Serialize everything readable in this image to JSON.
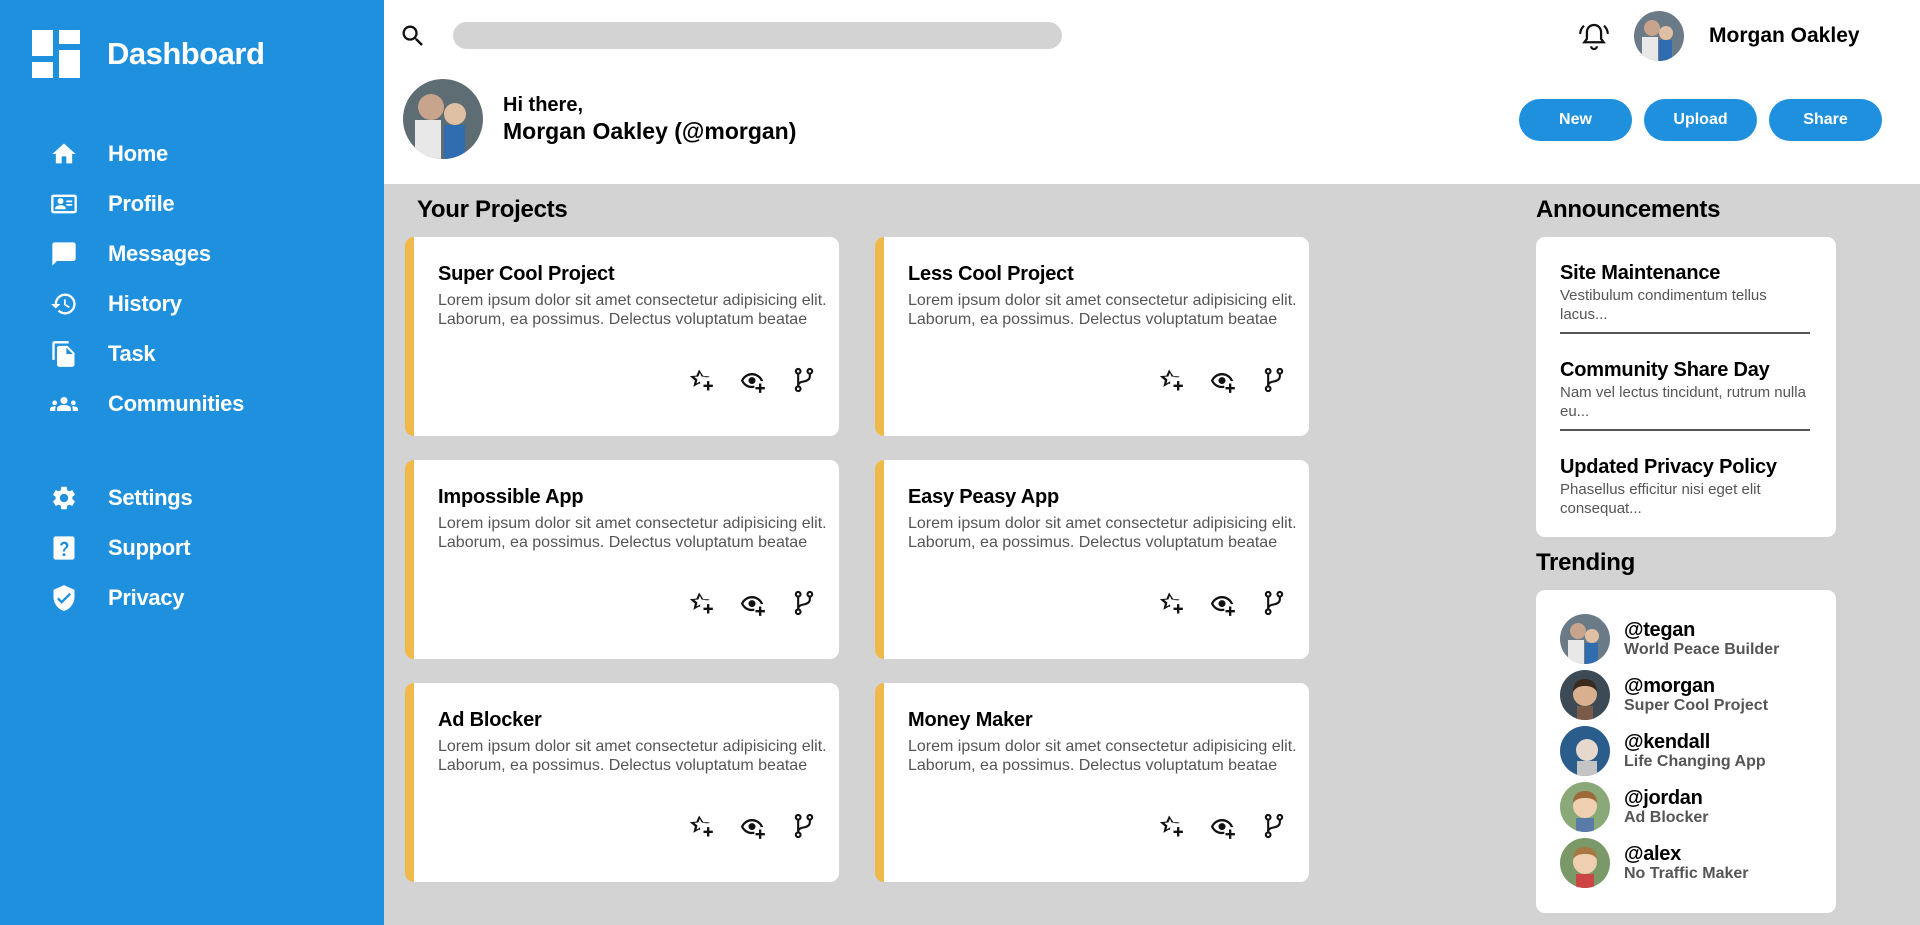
{
  "sidebar": {
    "brand": "Dashboard",
    "items": [
      {
        "label": "Home",
        "icon": "home-icon"
      },
      {
        "label": "Profile",
        "icon": "profile-card-icon"
      },
      {
        "label": "Messages",
        "icon": "message-icon"
      },
      {
        "label": "History",
        "icon": "history-icon"
      },
      {
        "label": "Task",
        "icon": "task-icon"
      },
      {
        "label": "Communities",
        "icon": "people-icon"
      }
    ],
    "secondary": [
      {
        "label": "Settings",
        "icon": "gear-icon"
      },
      {
        "label": "Support",
        "icon": "help-icon"
      },
      {
        "label": "Privacy",
        "icon": "shield-icon"
      }
    ]
  },
  "header": {
    "search_placeholder": "",
    "user_name": "Morgan Oakley",
    "greeting": "Hi there,",
    "full_name": "Morgan Oakley (@morgan)",
    "buttons": {
      "new": "New",
      "upload": "Upload",
      "share": "Share"
    }
  },
  "projects": {
    "title": "Your Projects",
    "items": [
      {
        "title": "Super Cool Project",
        "desc": "Lorem ipsum dolor sit amet consectetur adipisicing elit.\nLaborum, ea possimus. Delectus voluptatum beatae"
      },
      {
        "title": "Less Cool Project",
        "desc": "Lorem ipsum dolor sit amet consectetur adipisicing elit.\nLaborum, ea possimus. Delectus voluptatum beatae"
      },
      {
        "title": "Impossible App",
        "desc": "Lorem ipsum dolor sit amet consectetur adipisicing elit.\nLaborum, ea possimus. Delectus voluptatum beatae"
      },
      {
        "title": "Easy Peasy App",
        "desc": "Lorem ipsum dolor sit amet consectetur adipisicing elit.\nLaborum, ea possimus. Delectus voluptatum beatae"
      },
      {
        "title": "Ad Blocker",
        "desc": "Lorem ipsum dolor sit amet consectetur adipisicing elit.\nLaborum, ea possimus. Delectus voluptatum beatae"
      },
      {
        "title": "Money Maker",
        "desc": "Lorem ipsum dolor sit amet consectetur adipisicing elit.\nLaborum, ea possimus. Delectus voluptatum beatae"
      }
    ]
  },
  "announcements": {
    "title": "Announcements",
    "items": [
      {
        "title": "Site Maintenance",
        "text": "Vestibulum condimentum tellus lacus..."
      },
      {
        "title": "Community Share Day",
        "text": "Nam vel lectus tincidunt, rutrum nulla eu..."
      },
      {
        "title": "Updated Privacy Policy",
        "text": "Phasellus efficitur nisi eget elit consequat..."
      }
    ]
  },
  "trending": {
    "title": "Trending",
    "items": [
      {
        "handle": "@tegan",
        "project": "World Peace Builder"
      },
      {
        "handle": "@morgan",
        "project": "Super Cool Project"
      },
      {
        "handle": "@kendall",
        "project": "Life Changing App"
      },
      {
        "handle": "@jordan",
        "project": "Ad Blocker"
      },
      {
        "handle": "@alex",
        "project": "No Traffic Maker"
      }
    ]
  },
  "colors": {
    "accent": "#1e90dd",
    "card_stripe": "#f0b94c",
    "background": "#d3d3d3"
  }
}
